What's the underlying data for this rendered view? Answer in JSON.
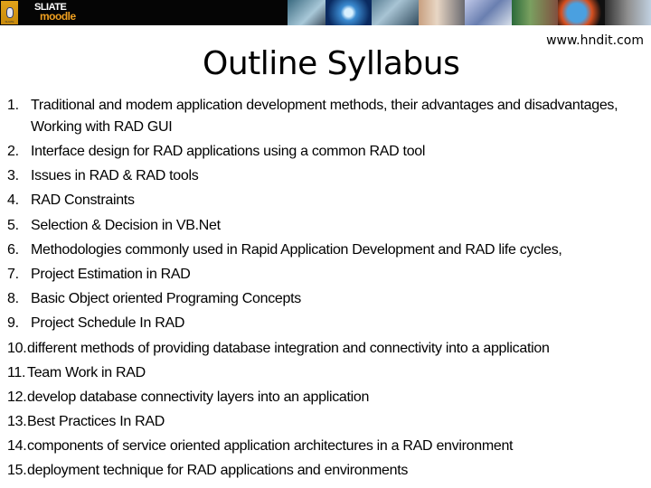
{
  "banner": {
    "logo": {
      "icon": "sliate-crest-icon",
      "badge_text": "SLIATE"
    },
    "brand": {
      "top": "SLIATE",
      "bottom": "moodle"
    },
    "photos": [
      "globe-photo",
      "touchscreen-photo",
      "students-photo",
      "keyboard-photo",
      "classroom-photo",
      "earth-photo",
      "robot-face-photo"
    ]
  },
  "slide": {
    "title": "Outline Syllabus",
    "website": "www.hndit.com",
    "items": [
      {
        "num": "1.",
        "text": "Traditional and modem application development methods, their advantages and disadvantages, Working with RAD GUI"
      },
      {
        "num": "2.",
        "text": "Interface design for RAD applications using a common RAD tool"
      },
      {
        "num": "3.",
        "text": "Issues in RAD & RAD tools"
      },
      {
        "num": "4.",
        "text": "RAD Constraints"
      },
      {
        "num": "5.",
        "text": "Selection & Decision in VB.Net"
      },
      {
        "num": "6.",
        "text": "Methodologies commonly used in Rapid Application Development and RAD life cycles,"
      },
      {
        "num": "7.",
        "text": "Project Estimation in RAD"
      },
      {
        "num": "8.",
        "text": "Basic Object oriented Programing Concepts"
      },
      {
        "num": "9.",
        "text": "Project Schedule In RAD"
      },
      {
        "num": "10.",
        "text": "different methods of providing database integration and connectivity into a application"
      },
      {
        "num": "11.",
        "text": "Team Work in RAD"
      },
      {
        "num": "12.",
        "text": "develop database connectivity layers into an application"
      },
      {
        "num": "13.",
        "text": "Best Practices In RAD"
      },
      {
        "num": "14.",
        "text": "components of service oriented application architectures in a RAD environment"
      },
      {
        "num": "15.",
        "text": "deployment technique for RAD applications and environments"
      }
    ]
  }
}
